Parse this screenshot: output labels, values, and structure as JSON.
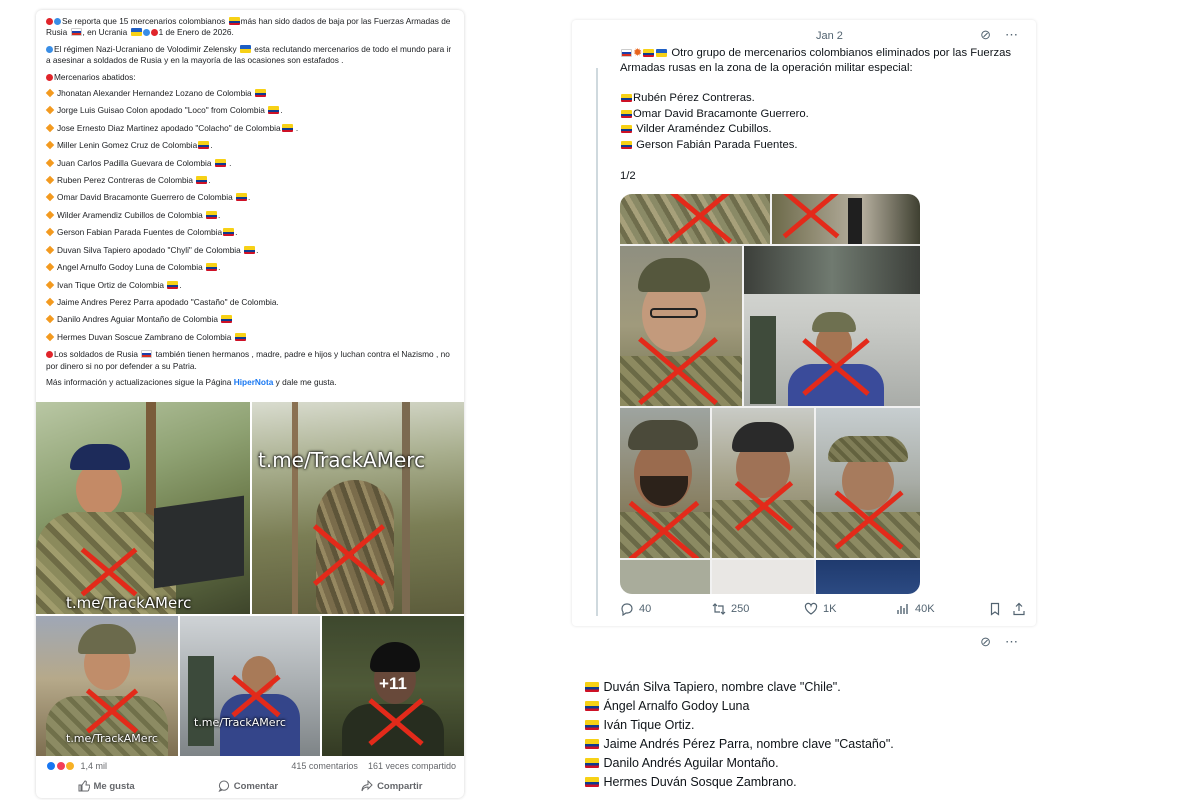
{
  "facebook": {
    "intro": "Se reporta que 15 mercenarios colombianos",
    "intro_2": "más han sido dados de baja por las Fuerzas Armadas de Rusia",
    "intro_3": ", en Ucrania",
    "intro_4": "1 de Enero de 2026.",
    "regime_a": "El régimen  Nazi-Ucraniano de Volodimir Zelensky",
    "regime_b": " esta reclutando mercenarios de todo el mundo para ir a asesinar a soldados de Rusia y en la mayoría de las ocasiones son estafados .",
    "list_header": "Mercenarios abatidos:",
    "mercenaries": [
      "Jhonatan Alexander Hernandez Lozano de Colombia",
      "Jorge Luis Guisao Colon apodado \"Loco\" from Colombia",
      "Jose Ernesto Diaz Martinez apodado \"Colacho\" de Colombia",
      "Miller Lenin Gomez Cruz de Colombia",
      "Juan Carlos Padilla Guevara de Colombia",
      "Ruben Perez Contreras de Colombia",
      "Omar David Bracamonte Guerrero de Colombia",
      "Wilder Aramendiz Cubillos de Colombia",
      "Gerson Fabian Parada Fuentes de Colombia",
      "Duvan Silva Tapiero apodado \"Chyli\" de Colombia",
      "Angel Arnulfo Godoy Luna de Colombia",
      "Ivan Tique Ortiz de Colombia",
      "Jaime Andres Perez Parra apodado \"Castaño\" de Colombia.",
      "Danilo Andres Aguiar Montaño de Colombia",
      "Hermes Duvan Soscue Zambrano de Colombia"
    ],
    "outro_a": "Los soldados de Rusia",
    "outro_b": " también tienen hermanos , madre, padre e hijos y luchan contra el Nazismo , no por dinero si no por defender a su Patria.",
    "more_info": "Más información y actualizaciones sigue la Página",
    "page_link": "HiperNota",
    "more_info_end": " y dale me gusta.",
    "watermark": "t.me/TrackAMerc",
    "more_photos": "+11",
    "reactions_count": "1,4 mil",
    "comments": "415 comentarios",
    "shares": "161 veces compartido",
    "actions": [
      "Me gusta",
      "Comentar",
      "Compartir"
    ]
  },
  "twitter": {
    "date": "Jan 2",
    "body": "Otro grupo de mercenarios colombianos eliminados por las Fuerzas Armadas rusas en la zona de la operación militar especial:",
    "names": [
      "Rubén Pérez Contreras.",
      "Omar David Bracamonte Guerrero.",
      " Vilder Araméndez Cubillos.",
      " Gerson Fabián Parada Fuentes."
    ],
    "pager": "1/2",
    "replies": "40",
    "retweets": "250",
    "likes": "1K",
    "views": "40K",
    "names_2": [
      "Duván Silva Tapiero, nombre clave \"Chile\".",
      "Ángel Arnalfo Godoy Luna",
      "Iván Tique Ortiz.",
      "Jaime Andrés Pérez Parra, nombre clave \"Castaño\".",
      "Danilo Andrés Aguilar Montaño.",
      "Hermes Duván Sosque Zambrano."
    ]
  },
  "colors": {
    "fb_link": "#1877f2",
    "x_mark": "#e32a1a",
    "tw_secondary": "#536471"
  },
  "icons": [
    "like-icon",
    "comment-icon",
    "share-icon",
    "reply-icon",
    "retweet-icon",
    "heart-icon",
    "views-icon",
    "bookmark-icon",
    "upload-icon",
    "grok-icon",
    "more-icon"
  ]
}
